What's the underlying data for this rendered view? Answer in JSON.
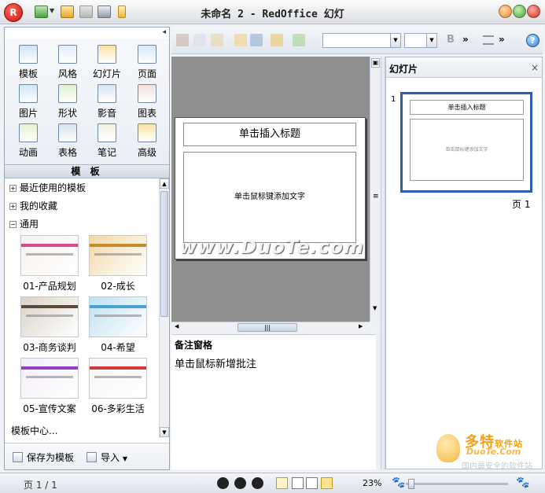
{
  "window": {
    "title": "未命名 2 - RedOffice 幻灯",
    "logo_text": "R"
  },
  "left_panel": {
    "categories": [
      {
        "label": "模板",
        "icon": "template-icon",
        "color": "#cfe3f7"
      },
      {
        "label": "风格",
        "icon": "style-icon",
        "color": "#e4eef9"
      },
      {
        "label": "幻灯片",
        "icon": "slide-icon",
        "color": "#f9e2a6"
      },
      {
        "label": "页面",
        "icon": "page-icon",
        "color": "#d6e8f9"
      },
      {
        "label": "图片",
        "icon": "picture-icon",
        "color": "#cde6f6"
      },
      {
        "label": "形状",
        "icon": "shape-icon",
        "color": "#dff0cf"
      },
      {
        "label": "影音",
        "icon": "media-icon",
        "color": "#d8e3f0"
      },
      {
        "label": "图表",
        "icon": "chart-icon",
        "color": "#f3dede"
      },
      {
        "label": "动画",
        "icon": "animation-icon",
        "color": "#e7f1d3"
      },
      {
        "label": "表格",
        "icon": "table-icon",
        "color": "#d7e2ef"
      },
      {
        "label": "笔记",
        "icon": "note-icon",
        "color": "#f3f0e1"
      },
      {
        "label": "高级",
        "icon": "advanced-icon",
        "color": "#fbe4a0"
      }
    ],
    "section_title": "模 板",
    "tree": [
      {
        "label": "最近使用的模板",
        "expanded": false
      },
      {
        "label": "我的收藏",
        "expanded": false
      },
      {
        "label": "通用",
        "expanded": true
      }
    ],
    "expand_symbol": "+",
    "collapse_symbol": "−",
    "templates": [
      {
        "label": "01-产品规划",
        "bg": "#f7f1ec",
        "bar": "#d84d8e"
      },
      {
        "label": "02-成长",
        "bg": "#f2d9a8",
        "bar": "#c98a2c"
      },
      {
        "label": "03-商务谈判",
        "bg": "#d9d3c8",
        "bar": "#5a4a3a"
      },
      {
        "label": "04-希望",
        "bg": "#bfe1f2",
        "bar": "#4c9fd1"
      },
      {
        "label": "05-宣传文案",
        "bg": "#f4eef7",
        "bar": "#8f42c2"
      },
      {
        "label": "06-多彩生活",
        "bg": "#f6f6f6",
        "bar": "#d2393a"
      }
    ],
    "template_center": "模板中心...",
    "save_as_template": "保存为模板",
    "import_label": "导入"
  },
  "toolbar": {
    "bold_label": "B",
    "more_label": "»",
    "help_label": "?"
  },
  "slide": {
    "title_placeholder": "单击插入标题",
    "body_placeholder": "单击鼠标键添加文字"
  },
  "watermark": "www.DuoTe.com",
  "notes": {
    "title": "备注窗格",
    "placeholder": "单击鼠标新增批注"
  },
  "slides_panel": {
    "title": "幻灯片",
    "close": "×",
    "slide_number": "1",
    "thumb_title": "单击插入标题",
    "thumb_body": "单击鼠标键添加文字",
    "page_label": "页 1"
  },
  "brand": {
    "main": "多特",
    "main_suffix": "软件站",
    "sub": "DuoTe.Com",
    "tagline": "国内最安全的软件站"
  },
  "statusbar": {
    "page": "页 1 / 1",
    "zoom": "23%"
  }
}
